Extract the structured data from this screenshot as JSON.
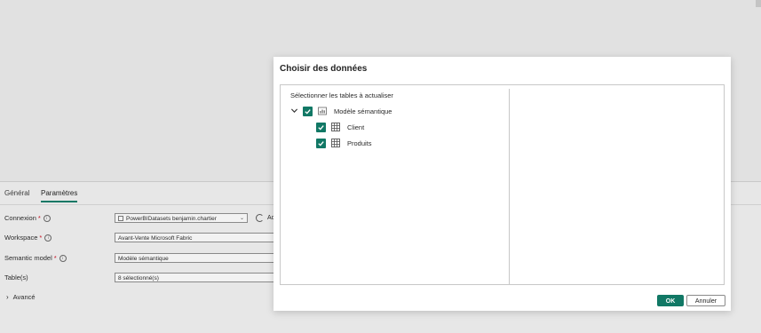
{
  "pane": {
    "tabs": [
      {
        "label": "Général",
        "active": false
      },
      {
        "label": "Paramètres",
        "active": true
      }
    ],
    "fields": {
      "connection": {
        "label": "Connexion",
        "value": "PowerBIDatasets benjamin.chartier",
        "required": "*"
      },
      "workspace": {
        "label": "Workspace",
        "value": "Avant-Vente Microsoft Fabric",
        "required": "*"
      },
      "semantic_model": {
        "label": "Semantic model",
        "value": "Modèle sémantique",
        "required": "*"
      },
      "tables": {
        "label": "Table(s)",
        "value": "8 sélectionné(s)",
        "required": ""
      }
    },
    "refresh_label": "Ac",
    "advanced_label": "Avancé"
  },
  "dialog": {
    "title": "Choisir des données",
    "section_label": "Sélectionner les tables à actualiser",
    "tree": {
      "root": {
        "label": "Modèle sémantique",
        "checked": true,
        "expanded": true,
        "icon": "semantic-model-icon"
      },
      "children": [
        {
          "label": "Client",
          "checked": true,
          "icon": "table-icon"
        },
        {
          "label": "Produits",
          "checked": true,
          "icon": "table-icon"
        }
      ]
    },
    "ok_label": "OK",
    "cancel_label": "Annuler"
  },
  "colors": {
    "accent": "#117865",
    "required": "#c50f1f",
    "background": "#e2e2e2"
  }
}
